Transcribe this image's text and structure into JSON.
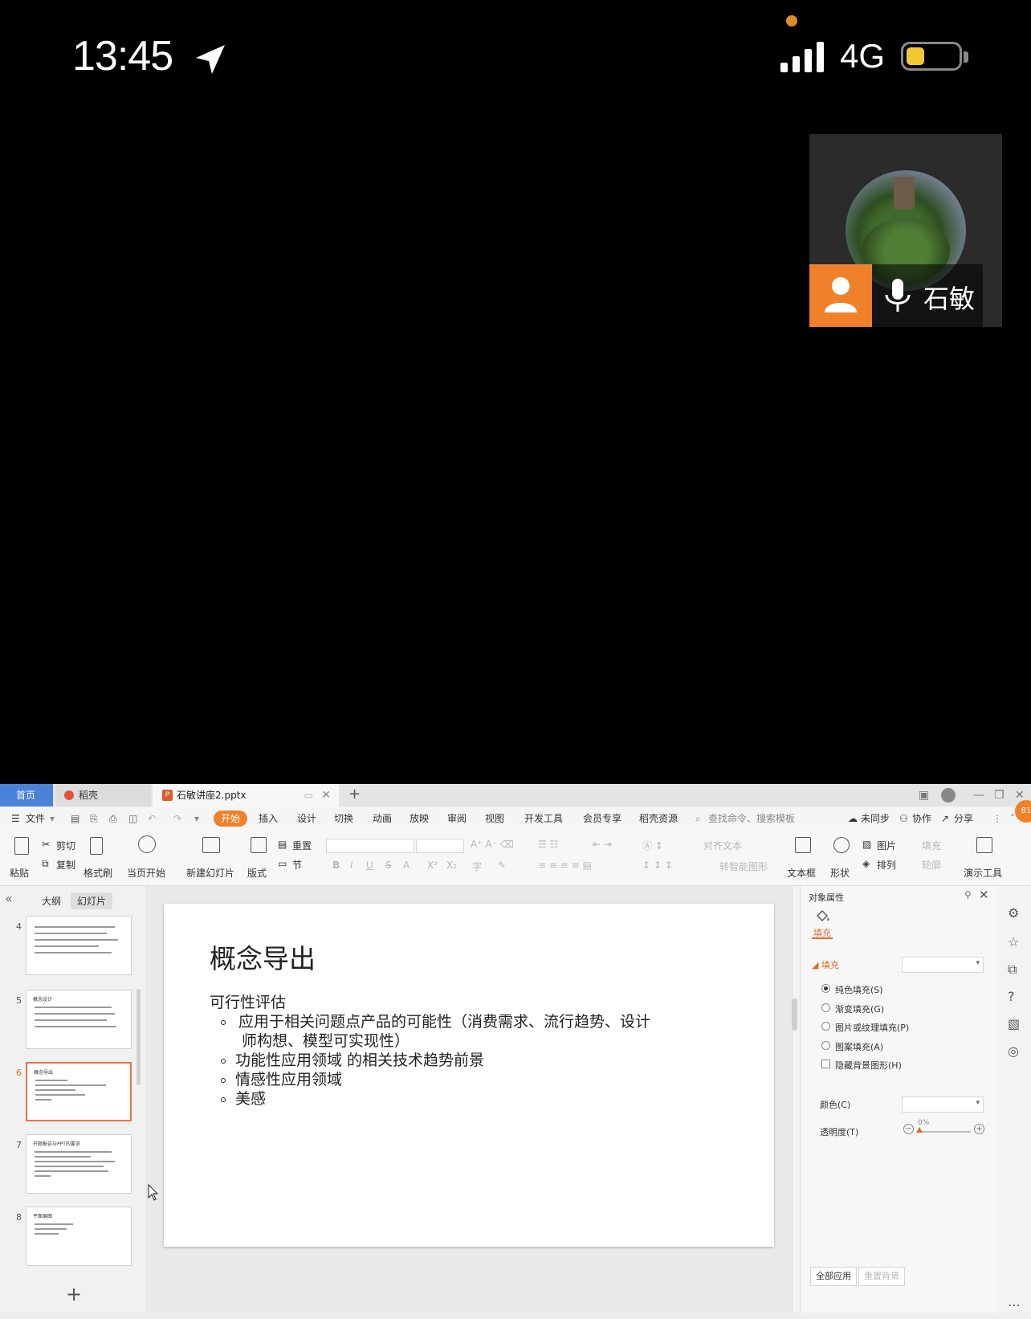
{
  "phone": {
    "time": "13:45",
    "network": "4G",
    "battery_level": 0.35,
    "colors": {
      "battery": "#f2c830",
      "recording_dot": "#e08a2c"
    }
  },
  "video_call": {
    "participant_name": "石敏",
    "avatar_icon": "user-icon",
    "mic_icon": "microphone-icon",
    "badge_color": "#f0812a"
  },
  "wps": {
    "tabs": {
      "home": "首页",
      "daoke": "稻壳",
      "file": "石敏讲座2.pptx"
    },
    "menu": {
      "file": "文件",
      "items": [
        "开始",
        "插入",
        "设计",
        "切换",
        "动画",
        "放映",
        "审阅",
        "视图",
        "开发工具",
        "会员专享",
        "稻壳资源"
      ],
      "search": "查找命令、搜索模板",
      "unsync": "未同步",
      "collab": "协作",
      "share": "分享"
    },
    "ribbon": {
      "paste": "粘贴",
      "cut": "剪切",
      "copy": "复制",
      "format_painter": "格式刷",
      "from_current": "当页开始",
      "new_slide": "新建幻灯片",
      "layout": "版式",
      "reset": "重置",
      "section": "节",
      "align_text": "对齐文本",
      "smart_shape": "转智能图形",
      "textbox": "文本框",
      "shape": "形状",
      "picture": "图片",
      "arrange": "排列",
      "fill": "填充",
      "outline": "轮廓",
      "presentation_tools": "演示工具"
    },
    "left_panel": {
      "tab_outline": "大纲",
      "tab_slides": "幻灯片",
      "slide_numbers": [
        "4",
        "5",
        "6",
        "7",
        "8"
      ],
      "thumb_titles": [
        "",
        "概念设计",
        "概念导出",
        "开题报告与PPT的要求",
        "平面展图"
      ]
    },
    "slide": {
      "title": "概念导出",
      "subtitle": "可行性评估",
      "bullets": [
        "应用于相关问题点产品的可能性（消费需求、流行趋势、设计",
        "师构想、模型可实现性）",
        "功能性应用领域 的相关技术趋势前景",
        "情感性应用领域",
        "美感"
      ]
    },
    "properties": {
      "title": "对象属性",
      "tab_fill": "填充",
      "section_fill": "填充",
      "options": [
        "纯色填充(S)",
        "渐变填充(G)",
        "图片或纹理填充(P)",
        "图案填充(A)"
      ],
      "hide_bg": "隐藏背景图形(H)",
      "color_label": "颜色(C)",
      "transparency_label": "透明度(T)",
      "transparency_value": "0%",
      "apply_all": "全部应用",
      "reset_bg": "重置背景"
    },
    "accent_color": "#f0812a"
  }
}
